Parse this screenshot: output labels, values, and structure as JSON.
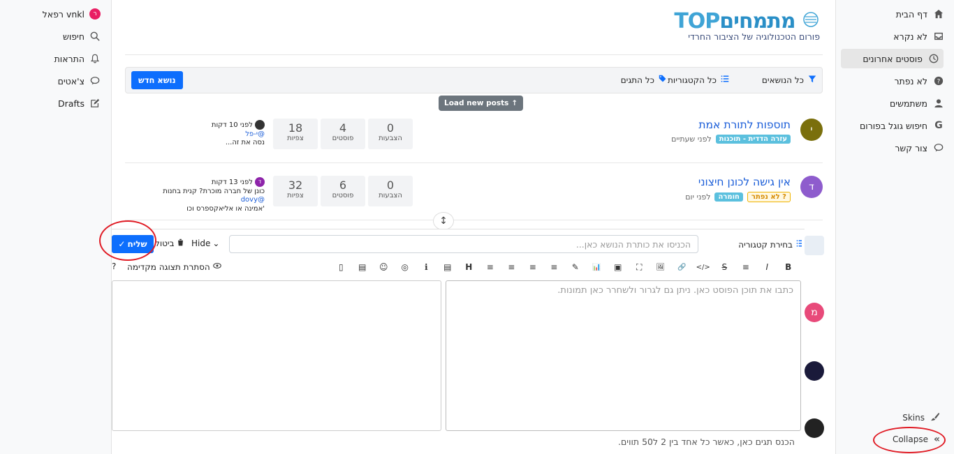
{
  "right_sidebar": {
    "items": [
      {
        "label": "דף הבית",
        "icon": "home-icon"
      },
      {
        "label": "לא נקרא",
        "icon": "inbox-icon"
      },
      {
        "label": "פוסטים אחרונים",
        "icon": "clock-icon"
      },
      {
        "label": "לא נפתר",
        "icon": "question-icon"
      },
      {
        "label": "משתמשים",
        "icon": "user-icon"
      },
      {
        "label": "חיפוש גוגל בפורום",
        "icon": "google-icon"
      },
      {
        "label": "צור קשר",
        "icon": "chat-icon"
      }
    ],
    "skins": "Skins",
    "collapse": "Collapse"
  },
  "left_sidebar": {
    "user": "רפאל vnkl",
    "user_initial": "ר",
    "search": "חיפוש",
    "notifications": "התראות",
    "chats": "צ'אטים",
    "drafts": "Drafts"
  },
  "header": {
    "logo_title_a": "מתמחים",
    "logo_title_b": "TOP",
    "logo_sub": "פורום הטכנולוגיה של הציבור החרדי"
  },
  "toolbar": {
    "new_topic": "נושא חדש",
    "all_topics": "כל הנושאים",
    "all_categories": "כל הקטגוריות",
    "all_tags": "כל התגים"
  },
  "load_new": "Load new posts",
  "topics": [
    {
      "title": "תוספות לתורת אמת",
      "avatar_letter": "י",
      "avatar_color": "#7a6f0c",
      "category": "עזרה הדדית - תוכנות",
      "category_color": "#5bc0de",
      "time": "לפני שעתיים",
      "votes": "0",
      "votes_label": "הצבעות",
      "posts": "4",
      "posts_label": "פוסטים",
      "views": "18",
      "views_label": "צפיות",
      "last_time": "לפני 10 דקות",
      "last_user": "@י-פל",
      "last_text": "נסה את זה..."
    },
    {
      "title": "אין גישה לכונן חיצוני",
      "avatar_letter": "ד",
      "avatar_color": "#8e5ccd",
      "unsolved": "לא נפתר",
      "category": "חומרה",
      "category_color": "#5bc0de",
      "time": "לפני יום",
      "votes": "0",
      "votes_label": "הצבעות",
      "posts": "6",
      "posts_label": "פוסטים",
      "views": "32",
      "views_label": "צפיות",
      "last_time": "לפני 13 דקות",
      "last_user": "@dovy",
      "last_text": "כונן של חברה מוכרת? קנית בחנות",
      "last_text2": "'אמינה או אליאקספרס וכו"
    }
  ],
  "composer": {
    "send": "שליח",
    "cancel": "ביטול",
    "hide": "Hide",
    "title_placeholder": "הכניסו את כותרת הנושא כאן...",
    "category": "בחירת קטגוריה",
    "preview_toggle": "הסתרת תצוגה מקדימה",
    "help": "?",
    "editor_placeholder": "כתבו את תוכן הפוסט כאן. ניתן גם לגרור ולשחרר כאן תמונות.",
    "tags_hint": "הכנס תגים כאן, כאשר כל אחד בין 2 ל50 תווים.",
    "format_buttons": [
      "B",
      "I",
      "≡",
      "S",
      "</>",
      "🔗",
      "🖼",
      "⛶",
      "▣",
      "📊",
      "✎",
      "≡",
      "≡",
      "≡",
      "≡",
      "H",
      "▤",
      "ℹ",
      "◎",
      "☺",
      "▤",
      "▯"
    ]
  },
  "annotation_color": "#e01b24"
}
